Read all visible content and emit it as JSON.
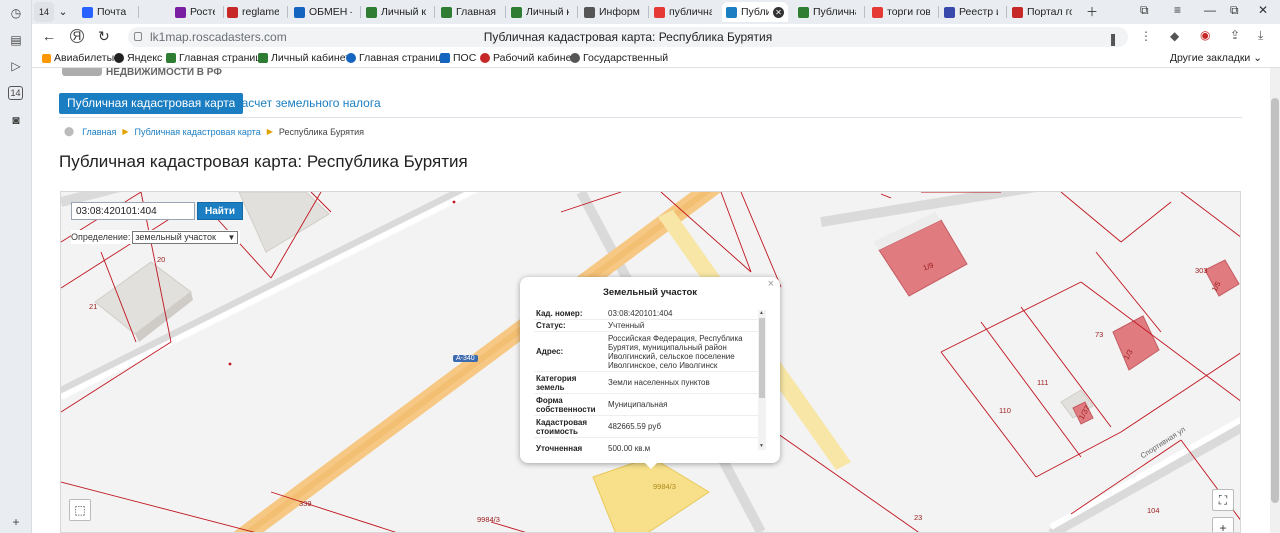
{
  "browser": {
    "tab_counter": "14",
    "tabs": [
      {
        "label": "Почта Ма",
        "color": "#2962ff"
      },
      {
        "label": "Ростелек",
        "color": "#7b1fa2"
      },
      {
        "label": "reglament",
        "color": "#c62828"
      },
      {
        "label": "ОБМЕН –",
        "color": "#1565c0"
      },
      {
        "label": "Личный к",
        "color": "#2e7d32"
      },
      {
        "label": "Главная с",
        "color": "#2e7d32"
      },
      {
        "label": "Личный к",
        "color": "#2e7d32"
      },
      {
        "label": "Информа",
        "color": "#555555"
      },
      {
        "label": "публична",
        "color": "#e53935"
      },
      {
        "label": "Публи",
        "color": "#1b7ec2"
      },
      {
        "label": "Публична",
        "color": "#2e7d32"
      },
      {
        "label": "торги гов",
        "color": "#e53935"
      },
      {
        "label": "Реестр из",
        "color": "#3949ab"
      },
      {
        "label": "Портал го",
        "color": "#c62828"
      }
    ],
    "url": "lk1map.roscadasters.com",
    "page_title": "Публичная кадастровая карта: Республика Бурятия",
    "bookmarks": [
      "Авиабилеты",
      "Яндекс",
      "Главная страница",
      "Личный кабинет",
      "Главная страница",
      "ПОС",
      "Рабочий кабинет",
      "Государственный"
    ],
    "other_bookmarks": "Другие закладки"
  },
  "site": {
    "subtitle": "НЕДВИЖИМОСТИ В РФ",
    "nav_active": "Публичная кадастровая карта",
    "nav_other": "Расчет земельного налога",
    "breadcrumb": [
      "Главная",
      "Публичная кадастровая карта",
      "Республика Бурятия"
    ],
    "heading": "Публичная кадастровая карта: Республика Бурятия"
  },
  "map": {
    "search_value": "03:08:420101:404",
    "search_button": "Найти",
    "definition_label": "Определение:",
    "definition_value": "земельный участок",
    "road_label": "А-340",
    "street_label": "Спортивная ул",
    "plot_labels": [
      "20",
      "21",
      "303",
      "73",
      "111",
      "110",
      "104",
      "339",
      "9984/3",
      "23",
      "1/37"
    ],
    "building_labels": [
      "1/9",
      "1/3",
      "1/5"
    ],
    "popup": {
      "title": "Земельный участок",
      "rows": [
        {
          "key": "Кад. номер:",
          "value": "03:08:420101:404"
        },
        {
          "key": "Статус:",
          "value": "Учтенный"
        },
        {
          "key": "Адрес:",
          "value": "Российская Федерация, Республика Бурятия, муниципальный район Иволгинский, сельское поселение Иволгинское, село Иволгинск"
        },
        {
          "key": "Категория земель",
          "value": "Земли населенных пунктов"
        },
        {
          "key": "Форма собственности",
          "value": "Муниципальная"
        },
        {
          "key": "Кадастровая стоимость",
          "value": "482665.59 руб"
        },
        {
          "key": "Уточненная",
          "value": "500.00 кв.м"
        }
      ]
    },
    "selected_plot_label": "9984/3"
  }
}
